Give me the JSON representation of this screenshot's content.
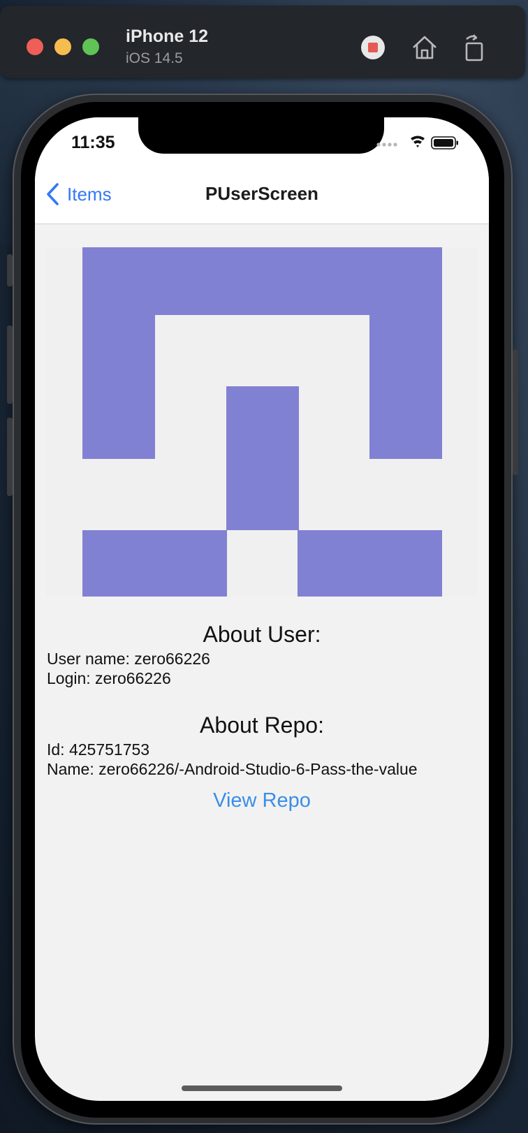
{
  "simulator": {
    "device_name": "iPhone 12",
    "os_version": "iOS 14.5",
    "icons": [
      "stop-icon",
      "home-icon",
      "rotate-icon"
    ]
  },
  "status_bar": {
    "time": "11:35",
    "icons": [
      "signal-dots-icon",
      "wifi-icon",
      "battery-icon"
    ]
  },
  "navbar": {
    "back_label": "Items",
    "title": "PUserScreen"
  },
  "avatar": {
    "foreground_color": "#8181d3",
    "background_color": "#f0f0f0"
  },
  "user_section": {
    "heading": "About User:",
    "user_name": "User name: zero66226",
    "login": "Login: zero66226"
  },
  "repo_section": {
    "heading": "About Repo:",
    "id": "Id: 425751753",
    "name": "Name: zero66226/-Android-Studio-6-Pass-the-value",
    "view_link": "View Repo"
  },
  "colors": {
    "accent_blue": "#3478f6",
    "link_blue": "#3a8ee6"
  }
}
